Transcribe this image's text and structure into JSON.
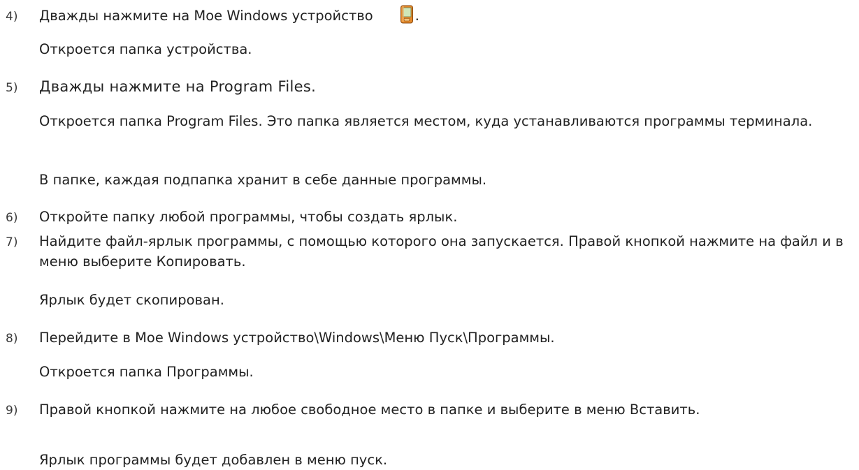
{
  "steps": [
    {
      "number": "4)",
      "text_before_icon": "Дважды нажмите на Мое Windows устройство",
      "icon": "windows-mobile-device-icon",
      "text_after_icon": "."
    },
    {
      "note": "Откроется папка устройства."
    },
    {
      "number": "5)",
      "text": "Дважды нажмите на Program Files."
    },
    {
      "note": "Откроется папка Program Files. Это папка является местом, куда устанавливаются программы терминала."
    },
    {
      "note": "В папке, каждая подпапка хранит в себе данные программы."
    },
    {
      "number": "6)",
      "text": "Откройте папку любой программы, чтобы создать ярлык."
    },
    {
      "number": "7)",
      "text": "Найдите файл-ярлык программы, с помощью которого она запускается. Правой кнопкой нажмите на файл и в меню выберите Копировать."
    },
    {
      "note": "Ярлык будет скопирован."
    },
    {
      "number": "8)",
      "text": "Перейдите в Мое Windows устройство\\Windows\\Меню Пуск\\Программы."
    },
    {
      "note": "Откроется папка Программы."
    },
    {
      "number": "9)",
      "text": "Правой кнопкой нажмите на любое свободное место в папке и выберите в меню Вставить."
    },
    {
      "note": "Ярлык программы будет добавлен в меню пуск."
    }
  ]
}
